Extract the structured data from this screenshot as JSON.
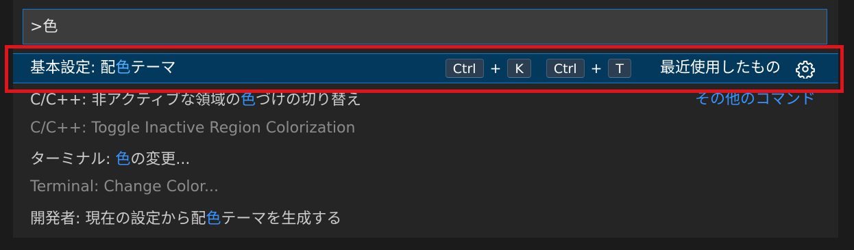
{
  "search": {
    "value": ">色"
  },
  "selected_item": {
    "label_prefix": "基本設定: 配",
    "label_highlight": "色",
    "label_suffix": "テーマ",
    "keybinding": {
      "chord1_key1": "Ctrl",
      "chord1_key2": "K",
      "chord2_key1": "Ctrl",
      "chord2_key2": "T",
      "plus": "+"
    },
    "badge": "最近使用したもの",
    "gear_icon": "gear-icon"
  },
  "other_commands_label": "その他のコマンド",
  "items": [
    {
      "prefix": "C/C++: 非アクティブな領域の",
      "highlight": "色",
      "suffix": "づけの切り替え"
    },
    {
      "text": "C/C++: Toggle Inactive Region Colorization"
    },
    {
      "prefix": "ターミナル: ",
      "highlight": "色",
      "suffix": "の変更..."
    },
    {
      "text": "Terminal: Change Color..."
    },
    {
      "prefix": "開発者: 現在の設定から配",
      "highlight": "色",
      "suffix": "テーマを生成する"
    }
  ],
  "colors": {
    "highlight": "#3794ff",
    "selection_bg": "#04395e",
    "annotation_border": "#e0151c",
    "focus_border": "#0e7ad3"
  }
}
